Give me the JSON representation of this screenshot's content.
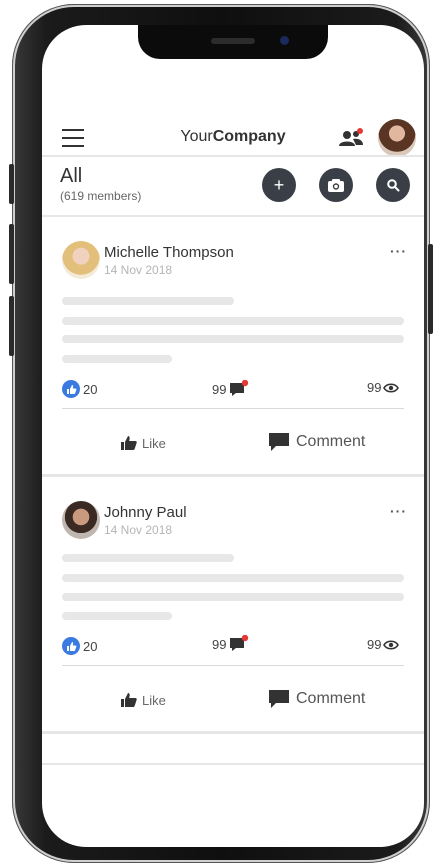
{
  "header": {
    "brand_regular": "Your",
    "brand_bold": "Company"
  },
  "filter": {
    "title": "All",
    "subtitle": "(619 members)"
  },
  "toolbar": {
    "add_label": "+"
  },
  "posts": [
    {
      "author": "Michelle Thompson",
      "date": "14 Nov 2018",
      "more": "···",
      "likes": "20",
      "comments": "99",
      "views": "99",
      "like_label": "Like",
      "comment_label": "Comment"
    },
    {
      "author": "Johnny Paul",
      "date": "14 Nov 2018",
      "more": "···",
      "likes": "20",
      "comments": "99",
      "views": "99",
      "like_label": "Like",
      "comment_label": "Comment"
    }
  ],
  "colors": {
    "accent_blue": "#3b7ae0",
    "notification_red": "#e53935",
    "dark_button": "#3a3f47"
  },
  "icons": [
    "hamburger-icon",
    "people-icon",
    "plus-icon",
    "camera-icon",
    "search-icon",
    "thumbs-up-icon",
    "comment-icon",
    "eye-icon"
  ]
}
